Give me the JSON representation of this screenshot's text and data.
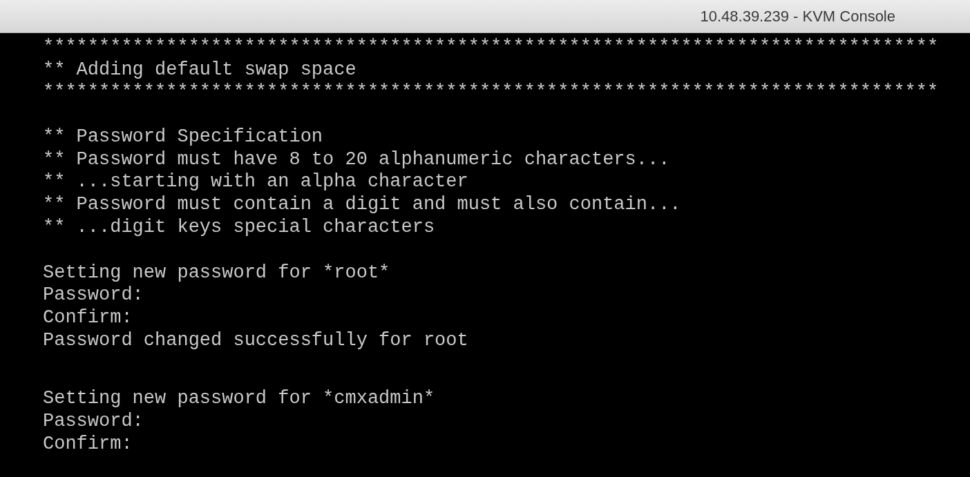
{
  "window": {
    "title": "10.48.39.239 - KVM Console"
  },
  "console": {
    "blocks": [
      {
        "lines": [
          "********************************************************************************",
          "** Adding default swap space",
          "********************************************************************************"
        ]
      },
      {
        "lines": [
          "** Password Specification",
          "** Password must have 8 to 20 alphanumeric characters...",
          "** ...starting with an alpha character",
          "** Password must contain a digit and must also contain...",
          "** ...digit keys special characters"
        ]
      },
      {
        "lines": [
          "Setting new password for *root*",
          "Password:",
          "Confirm:",
          "Password changed successfully for root"
        ]
      },
      {
        "lines": [
          "Setting new password for *cmxadmin*",
          "Password:",
          "Confirm:"
        ]
      }
    ]
  }
}
